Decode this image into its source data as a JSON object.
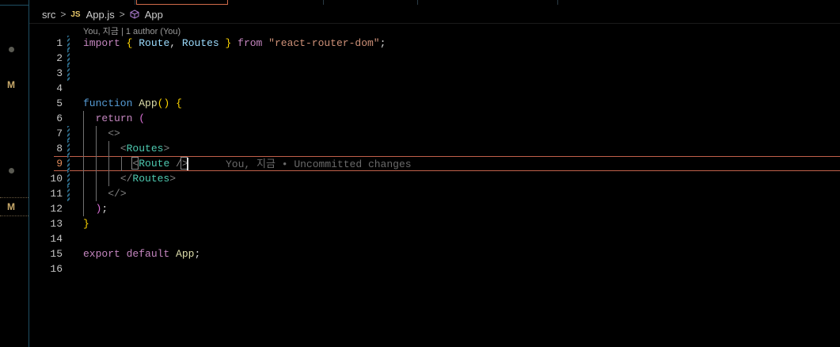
{
  "breadcrumb": {
    "folder": "src",
    "file_type": "JS",
    "file": "App.js",
    "symbol": "App"
  },
  "codelens": "You, 지금 | 1 author (You)",
  "blame": "You, 지금 • Uncommitted changes",
  "scm_badges": [
    "M",
    "M"
  ],
  "current_line": 9,
  "lines": [
    {
      "n": "1"
    },
    {
      "n": "2"
    },
    {
      "n": "3"
    },
    {
      "n": "4"
    },
    {
      "n": "5"
    },
    {
      "n": "6"
    },
    {
      "n": "7"
    },
    {
      "n": "8"
    },
    {
      "n": "9"
    },
    {
      "n": "10"
    },
    {
      "n": "11"
    },
    {
      "n": "12"
    },
    {
      "n": "13"
    },
    {
      "n": "14"
    },
    {
      "n": "15"
    },
    {
      "n": "16"
    }
  ],
  "code": {
    "l1": {
      "import": "import",
      "ob": "{",
      "route": "Route",
      "comma": ",",
      "routes": "Routes",
      "cb": "}",
      "from": "from",
      "src": "\"react-router-dom\"",
      "semi": ";"
    },
    "l5": {
      "function": "function",
      "name": "App",
      "parens": "()",
      "ob": "{"
    },
    "l6": {
      "return": "return",
      "op": "("
    },
    "l7": {
      "frag": "<>"
    },
    "l8": {
      "open": "<",
      "tag": "Routes",
      "close": ">"
    },
    "l9": {
      "open": "<",
      "tag": "Route",
      "close": " />"
    },
    "l10": {
      "open": "</",
      "tag": "Routes",
      "close": ">"
    },
    "l11": {
      "frag": "</>"
    },
    "l12": {
      "cp": ")",
      "semi": ";"
    },
    "l13": {
      "cb": "}"
    },
    "l15": {
      "export": "export",
      "default": "default",
      "name": "App",
      "semi": ";"
    }
  },
  "colors": {
    "keyword": "#569cd6",
    "control": "#c586c0",
    "string": "#ce9178",
    "identifier": "#9cdcfe",
    "function": "#dcdcaa",
    "tag": "#4ec9b0",
    "current_line_border": "#c0604a"
  }
}
